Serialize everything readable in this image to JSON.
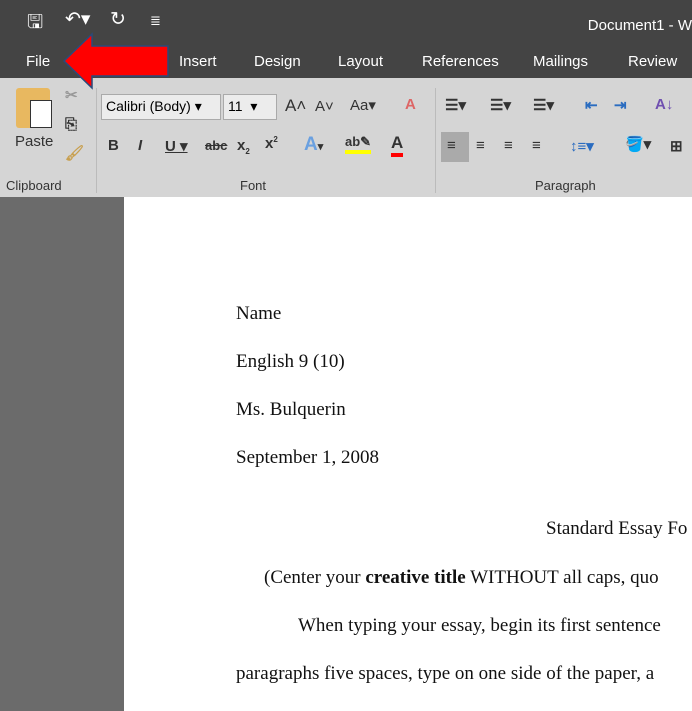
{
  "window": {
    "title": "Document1 - W"
  },
  "qat": {
    "save_icon": "save-icon",
    "undo_icon": "undo-icon",
    "redo_icon": "redo-icon",
    "customize_icon": "customize-icon"
  },
  "tabs": [
    {
      "label": "File"
    },
    {
      "label": "Insert"
    },
    {
      "label": "Design"
    },
    {
      "label": "Layout"
    },
    {
      "label": "References"
    },
    {
      "label": "Mailings"
    },
    {
      "label": "Review"
    }
  ],
  "ribbon": {
    "clipboard": {
      "paste_label": "Paste",
      "group_label": "Clipboard"
    },
    "font": {
      "font_name": "Calibri (Body)",
      "font_size": "11",
      "group_label": "Font",
      "highlight_color": "#ffff00",
      "font_color": "#ff0000"
    },
    "paragraph": {
      "group_label": "Paragraph"
    }
  },
  "annotation": {
    "arrow_color": "#ff0000"
  },
  "document": {
    "lines": [
      "Name",
      "English 9 (10)",
      "Ms. Bulquerin",
      "September 1, 2008",
      "Standard Essay Fo"
    ],
    "center_pre": "(Center your ",
    "center_bold1": "creative title",
    "center_post": " WITHOUT all caps, quo",
    "body1": "When typing your essay, begin its first sentence",
    "body2": "paragraphs five spaces, type on one side of the paper, a"
  }
}
